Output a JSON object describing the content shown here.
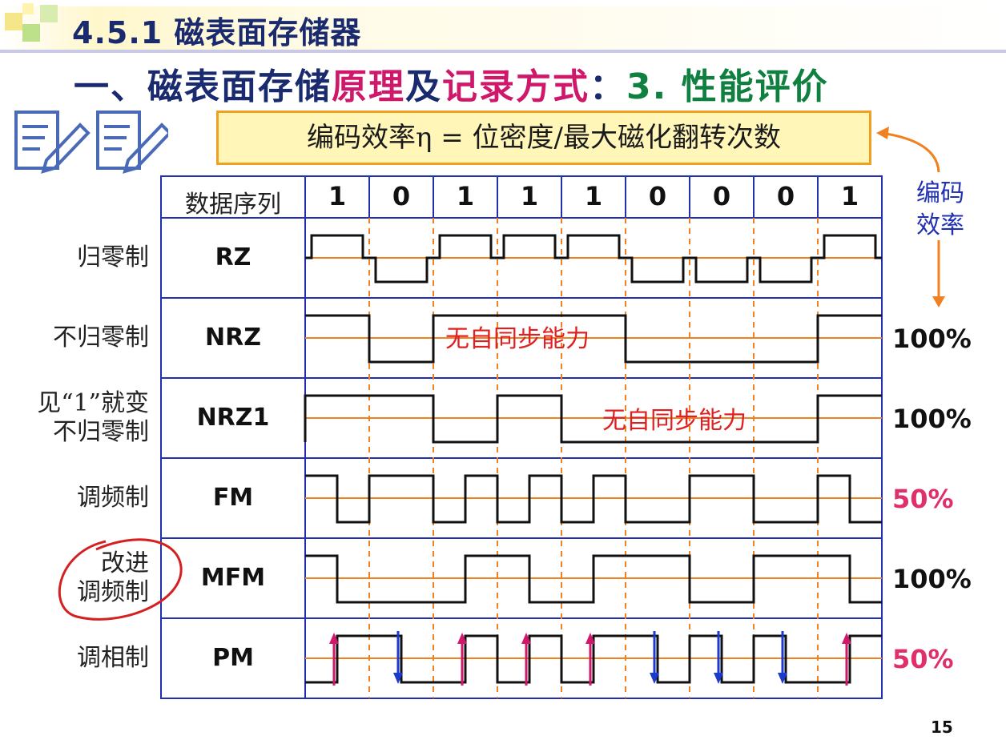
{
  "title": "4.5.1 磁表面存储器",
  "subtitle": {
    "part1": "一、磁表面存储",
    "part2": "原理",
    "part3": "及",
    "part4": "记录方式",
    "part5": "：",
    "part6": "3. 性能评价"
  },
  "formula": "编码效率η = 位密度/最大磁化翻转次数",
  "efficiency_label": [
    "编码",
    "效率"
  ],
  "header": {
    "label": "数据序列",
    "bits": [
      "1",
      "0",
      "1",
      "1",
      "1",
      "0",
      "0",
      "0",
      "1"
    ]
  },
  "rows": [
    {
      "name": "归零制",
      "code": "RZ",
      "efficiency": ""
    },
    {
      "name": "不归零制",
      "code": "NRZ",
      "efficiency": "100%"
    },
    {
      "name": "见“1”就变\n不归零制",
      "code": "NRZ1",
      "efficiency": "100%"
    },
    {
      "name": "调频制",
      "code": "FM",
      "efficiency": "50%"
    },
    {
      "name": "改进\n调频制",
      "code": "MFM",
      "efficiency": "100%"
    },
    {
      "name": "调相制",
      "code": "PM",
      "efficiency": "50%"
    }
  ],
  "notes": {
    "nrz": "无自同步能力",
    "nrz1": "无自同步能力"
  },
  "colors": {
    "title": "#1a2a6e",
    "accent_pink": "#d0186b",
    "accent_green": "#108040",
    "grid": "#2030b0",
    "waveform": "#111111",
    "baseline": "#f08020",
    "clock_dash": "#f08020",
    "efficiency_50": "#e0306a",
    "note_red": "#e02020",
    "arrow_up": "#d0186b",
    "arrow_down": "#1a3ad0"
  },
  "page_number": "15"
}
